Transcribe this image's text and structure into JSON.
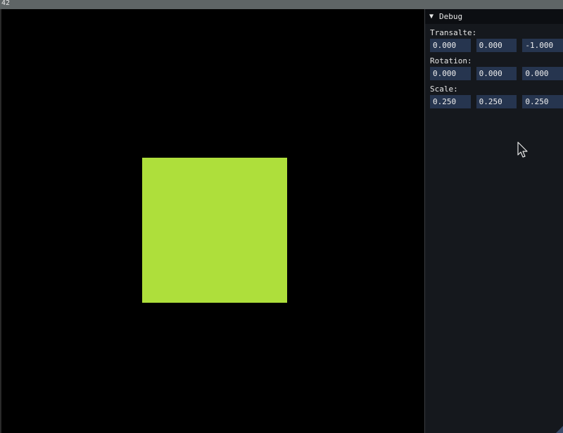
{
  "window": {
    "title": "42"
  },
  "colors": {
    "quad": "#aedf3b",
    "field_bg": "#26354f"
  },
  "debug": {
    "header": "Debug",
    "collapse_icon": "triangle-down-icon",
    "translate": {
      "label": "Transalte:",
      "values": [
        "0.000",
        "0.000",
        "-1.000"
      ]
    },
    "rotation": {
      "label": "Rotation:",
      "values": [
        "0.000",
        "0.000",
        "0.000"
      ]
    },
    "scale": {
      "label": "Scale:",
      "values": [
        "0.250",
        "0.250",
        "0.250"
      ]
    }
  }
}
